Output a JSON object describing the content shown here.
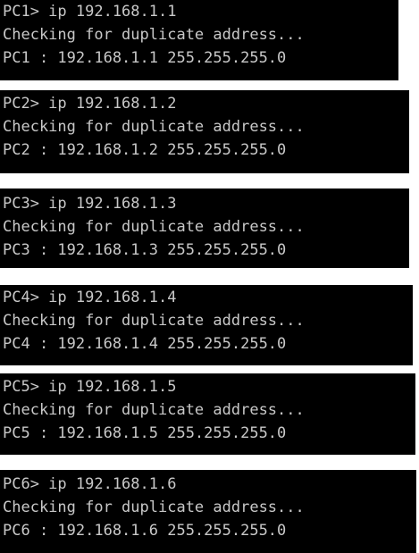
{
  "terminals": [
    {
      "prompt": "PC1> ip 192.168.1.1",
      "status": "Checking for duplicate address...",
      "result": "PC1 : 192.168.1.1 255.255.255.0"
    },
    {
      "prompt": "PC2> ip 192.168.1.2",
      "status": "Checking for duplicate address...",
      "result": "PC2 : 192.168.1.2 255.255.255.0"
    },
    {
      "prompt": "PC3> ip 192.168.1.3",
      "status": "Checking for duplicate address...",
      "result": "PC3 : 192.168.1.3 255.255.255.0"
    },
    {
      "prompt": "PC4> ip 192.168.1.4",
      "status": "Checking for duplicate address...",
      "result": "PC4 : 192.168.1.4 255.255.255.0"
    },
    {
      "prompt": "PC5> ip 192.168.1.5",
      "status": "Checking for duplicate address...",
      "result": "PC5 : 192.168.1.5 255.255.255.0"
    },
    {
      "prompt": "PC6> ip 192.168.1.6",
      "status": "Checking for duplicate address...",
      "result": "PC6 : 192.168.1.6 255.255.255.0"
    }
  ],
  "colors": {
    "terminal_background": "#000000",
    "terminal_text": "#c8c8c8",
    "page_background": "#ffffff"
  }
}
